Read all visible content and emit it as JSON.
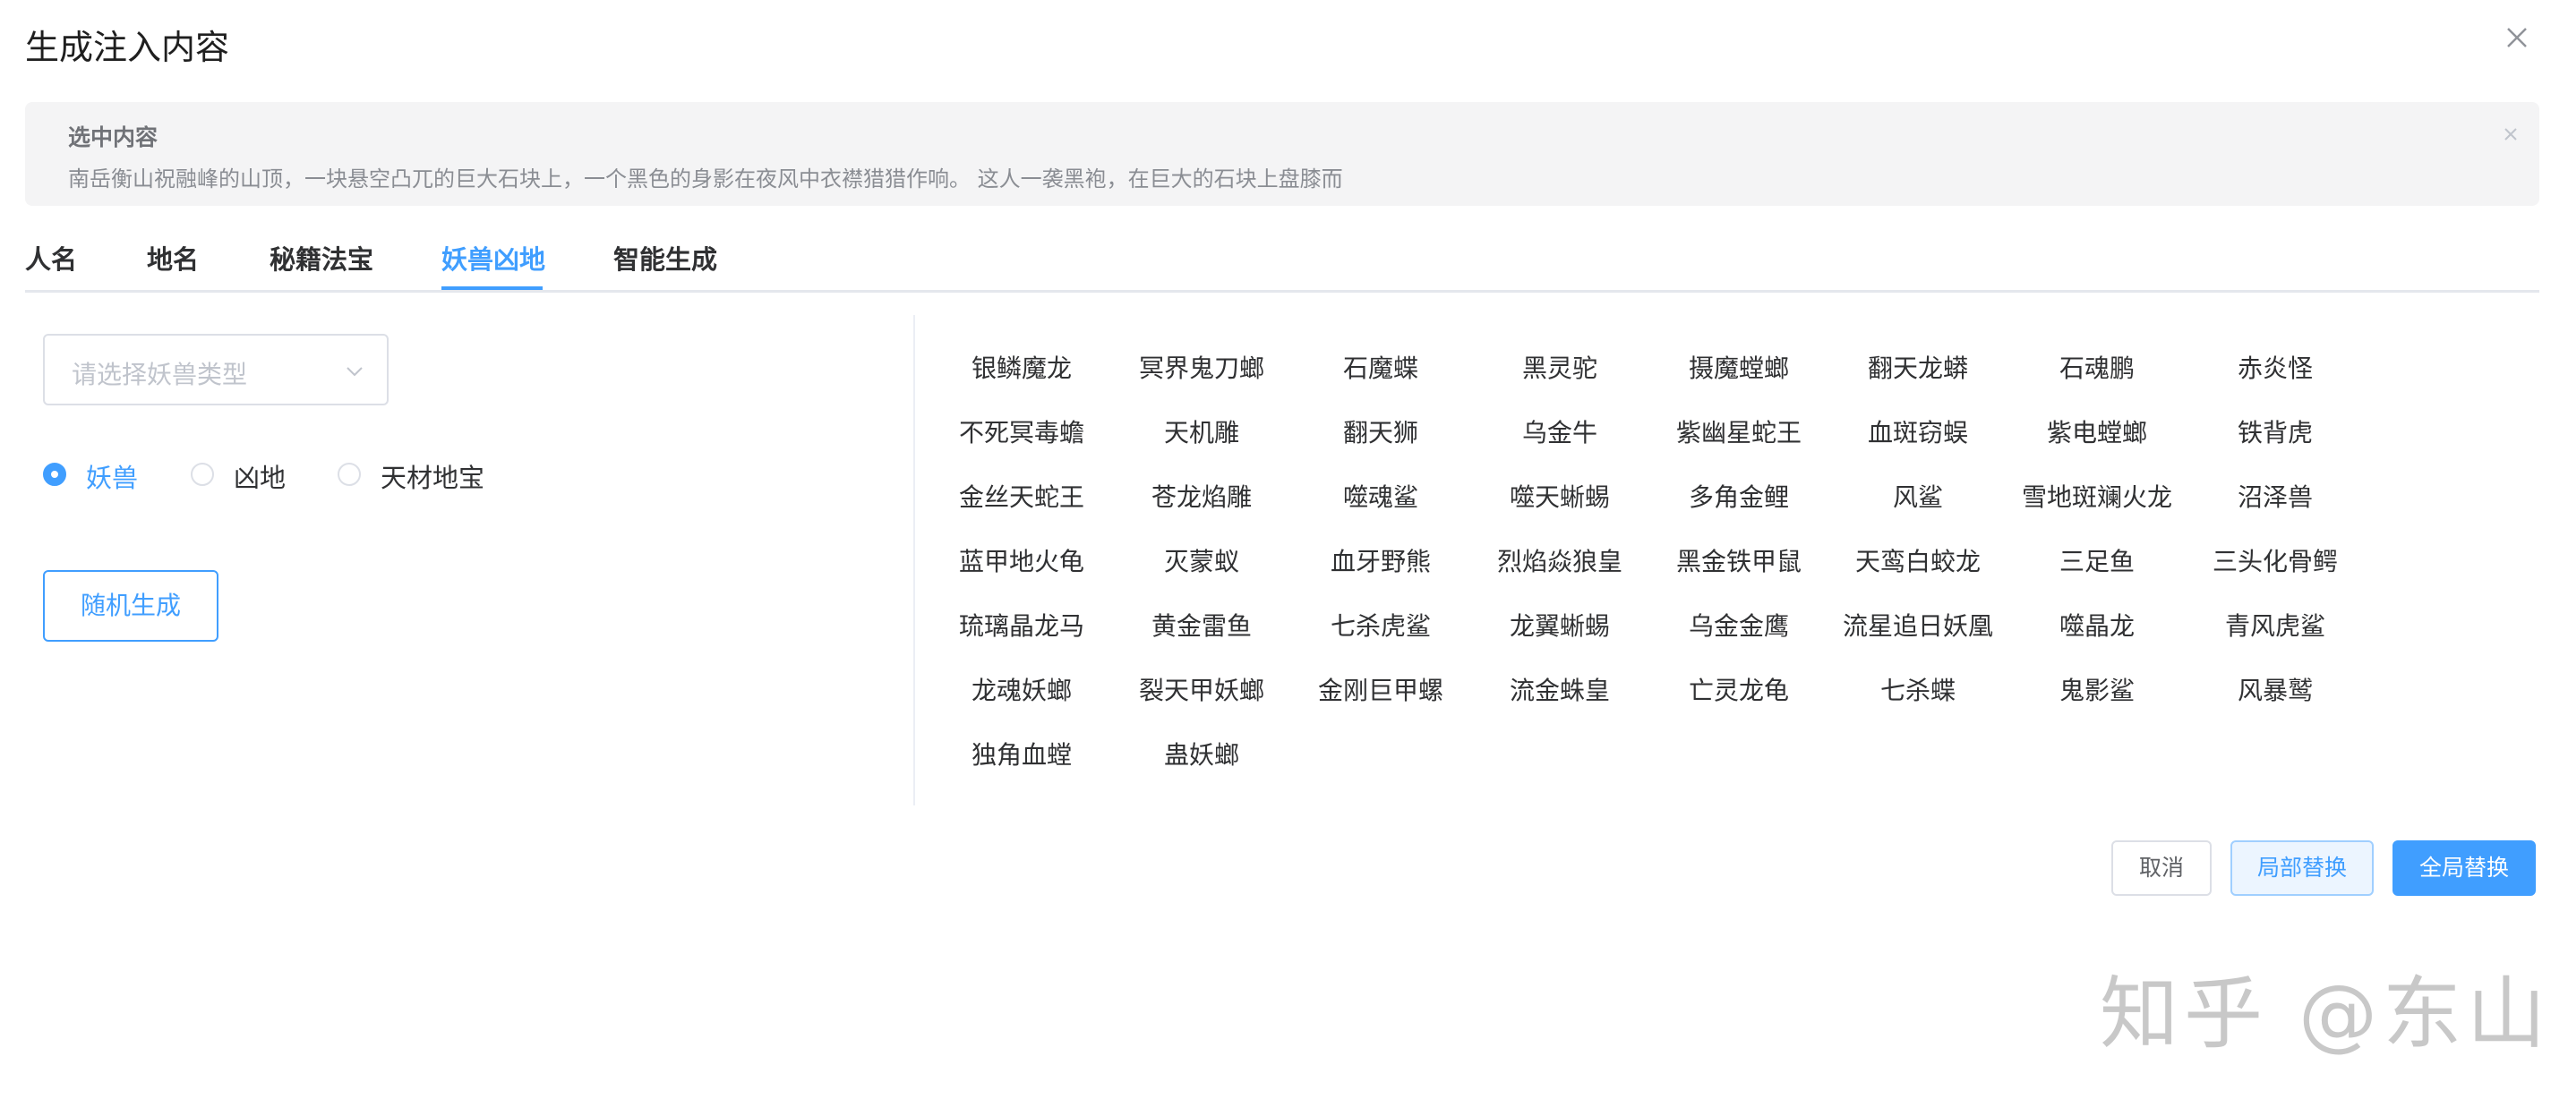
{
  "dialog": {
    "title": "生成注入内容"
  },
  "selected": {
    "title": "选中内容",
    "text": "南岳衡山祝融峰的山顶，一块悬空凸兀的巨大石块上，一个黑色的身影在夜风中衣襟猎猎作响。 这人一袭黑袍，在巨大的石块上盘膝而"
  },
  "tabs": [
    {
      "label": "人名"
    },
    {
      "label": "地名"
    },
    {
      "label": "秘籍法宝"
    },
    {
      "label": "妖兽凶地"
    },
    {
      "label": "智能生成"
    }
  ],
  "active_tab": "妖兽凶地",
  "form": {
    "select_placeholder": "请选择妖兽类型",
    "radios": [
      {
        "label": "妖兽",
        "checked": true
      },
      {
        "label": "凶地",
        "checked": false
      },
      {
        "label": "天材地宝",
        "checked": false
      }
    ],
    "random_button": "随机生成"
  },
  "results": [
    [
      "银鳞魔龙",
      "冥界鬼刀螂",
      "石魔蝶",
      "黑灵驼",
      "摄魔螳螂",
      "翻天龙蟒",
      "石魂鹏",
      "赤炎怪"
    ],
    [
      "不死冥毒蟾",
      "天机雕",
      "翻天狮",
      "乌金牛",
      "紫幽星蛇王",
      "血斑窃蜈",
      "紫电螳螂",
      "铁背虎"
    ],
    [
      "金丝天蛇王",
      "苍龙焰雕",
      "噬魂鲨",
      "噬天蜥蜴",
      "多角金鲤",
      "风鲨",
      "雪地斑斓火龙",
      "沼泽兽"
    ],
    [
      "蓝甲地火龟",
      "灭蒙蚁",
      "血牙野熊",
      "烈焰焱狼皇",
      "黑金铁甲鼠",
      "天鸾白蛟龙",
      "三足鱼",
      "三头化骨鳄"
    ],
    [
      "琉璃晶龙马",
      "黄金雷鱼",
      "七杀虎鲨",
      "龙翼蜥蜴",
      "乌金金鹰",
      "流星追日妖凰",
      "噬晶龙",
      "青风虎鲨"
    ],
    [
      "龙魂妖螂",
      "裂天甲妖螂",
      "金刚巨甲螺",
      "流金蛛皇",
      "亡灵龙龟",
      "七杀蝶",
      "鬼影鲨",
      "风暴鹫"
    ],
    [
      "独角血螳",
      "蛊妖螂"
    ]
  ],
  "footer": {
    "cancel": "取消",
    "local_replace": "局部替换",
    "global_replace": "全局替换"
  },
  "watermark": "知乎 @东山",
  "colors": {
    "accent": "#409eff",
    "panel_bg": "#f4f4f5",
    "border": "#dcdfe6"
  }
}
